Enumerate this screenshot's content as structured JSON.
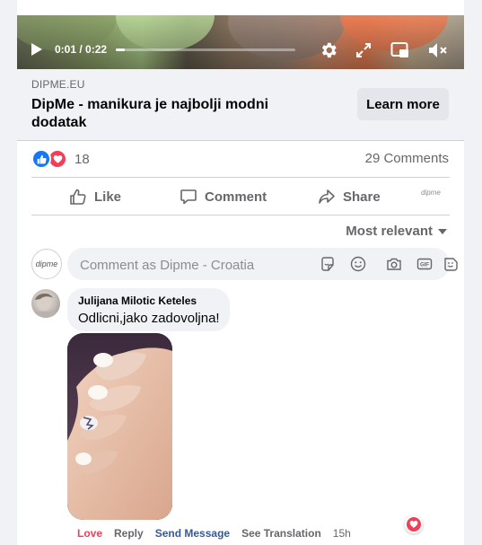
{
  "video": {
    "time": "0:01 / 0:22",
    "progress_fraction": 0.05,
    "controls": [
      "play-icon",
      "gear-icon",
      "fullscreen-icon",
      "picture-in-picture-icon",
      "volume-muted-icon"
    ]
  },
  "link_preview": {
    "domain": "DIPME.EU",
    "title": "DipMe - manikura je najbolji modni dodatak",
    "cta": "Learn more"
  },
  "reactions": {
    "icons": [
      "like-icon",
      "love-icon"
    ],
    "count": "18",
    "comments": "29 Comments"
  },
  "actions": {
    "like": "Like",
    "comment": "Comment",
    "share": "Share",
    "page_mark": "dipme"
  },
  "sort": {
    "label": "Most relevant"
  },
  "composer": {
    "avatar_text": "dipme",
    "placeholder": "Comment as Dipme - Croatia",
    "icons": [
      "sticker-icon",
      "emoji-icon",
      "camera-icon",
      "gif-icon",
      "sticker-face-icon"
    ]
  },
  "comment": {
    "author": "Julijana Milotic Keteles",
    "text": "Odlicni,jako zadovoljna!",
    "love": "Love",
    "reply": "Reply",
    "send_message": "Send Message",
    "see_translation": "See Translation",
    "time": "15h"
  },
  "colors": {
    "accent": "#1877f2",
    "love": "#f33e58",
    "send_message": "#385898",
    "muted_text": "#65676b"
  }
}
